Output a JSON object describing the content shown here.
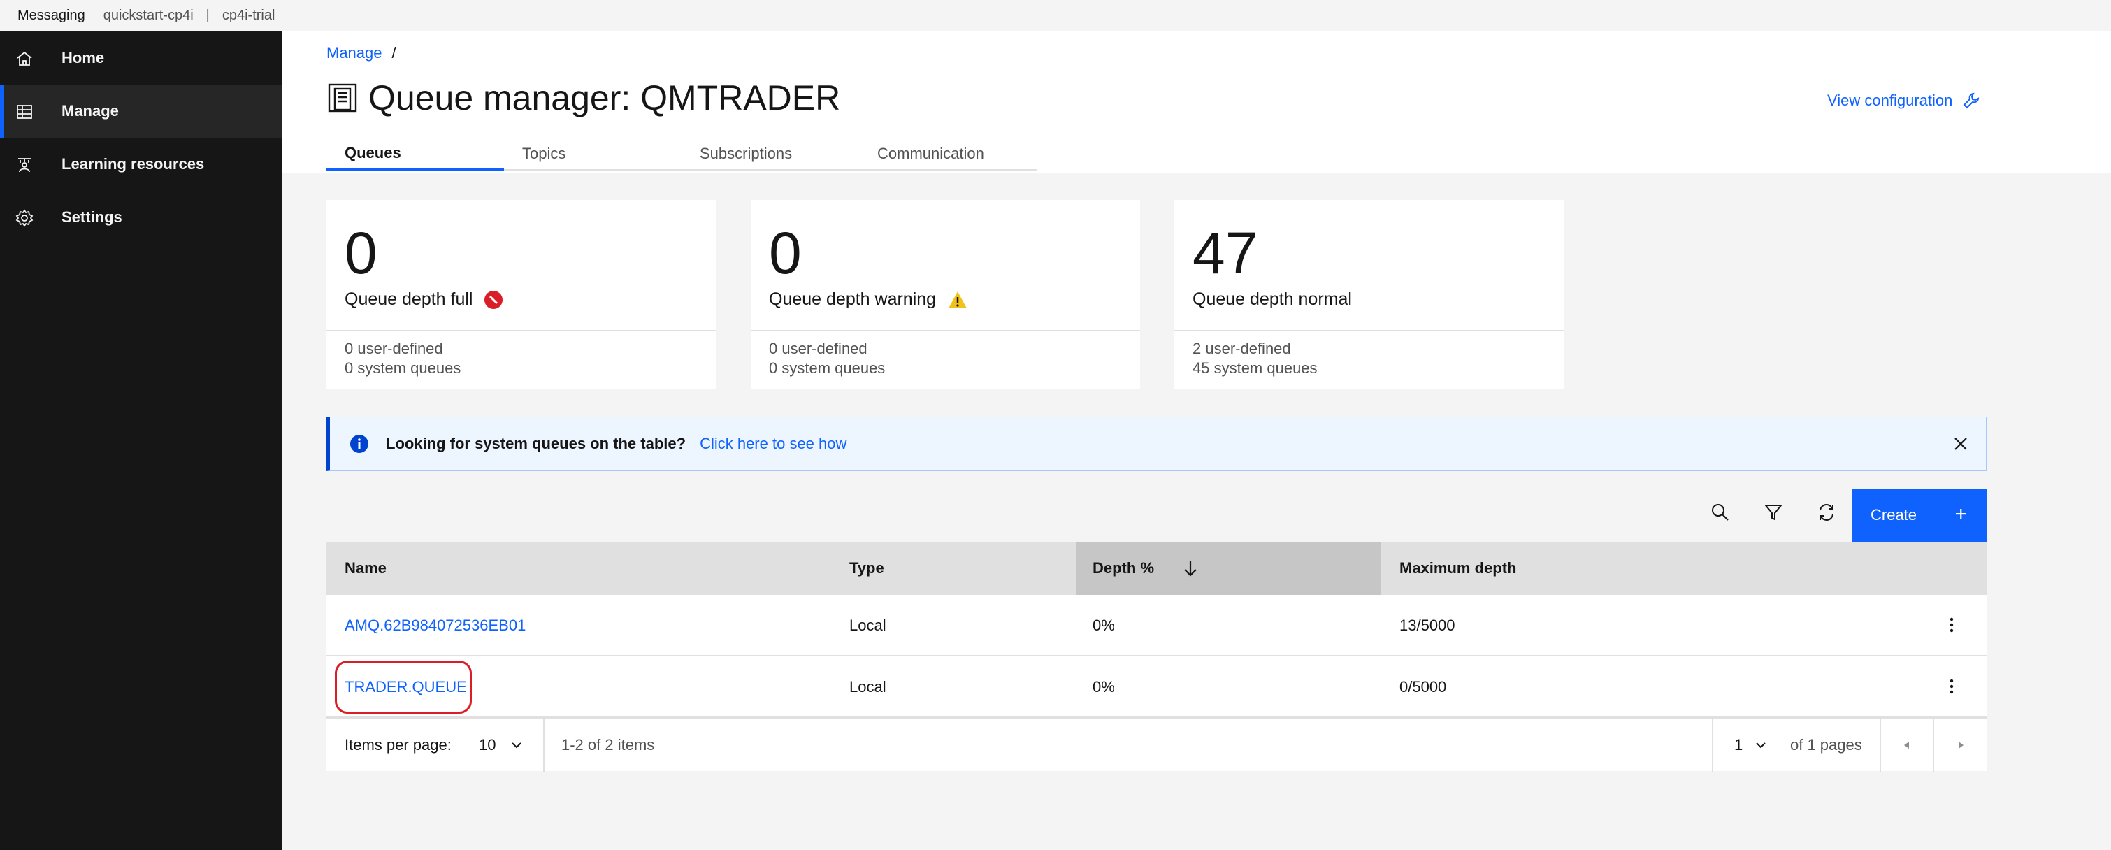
{
  "topbar": {
    "brand": "Messaging",
    "instance": "quickstart-cp4i",
    "separator": "|",
    "namespace": "cp4i-trial"
  },
  "sidebar": {
    "items": [
      {
        "label": "Home",
        "icon": "home-icon"
      },
      {
        "label": "Manage",
        "icon": "table-icon",
        "active": true
      },
      {
        "label": "Learning resources",
        "icon": "learning-icon"
      },
      {
        "label": "Settings",
        "icon": "gear-icon"
      }
    ]
  },
  "breadcrumb": {
    "root": "Manage",
    "separator": "/"
  },
  "page": {
    "title": "Queue manager: QMTRADER",
    "view_config": "View configuration"
  },
  "tabs": [
    {
      "label": "Queues",
      "active": true
    },
    {
      "label": "Topics"
    },
    {
      "label": "Subscriptions"
    },
    {
      "label": "Communication"
    }
  ],
  "tiles": [
    {
      "value": "0",
      "label": "Queue depth full",
      "status": "error",
      "user_defined": "0  user-defined",
      "system": "0  system queues"
    },
    {
      "value": "0",
      "label": "Queue depth warning",
      "status": "warning",
      "user_defined": "0  user-defined",
      "system": "0  system queues"
    },
    {
      "value": "47",
      "label": "Queue depth normal",
      "status": "none",
      "user_defined": "2  user-defined",
      "system": "45  system queues"
    }
  ],
  "notification": {
    "title": "Looking for system queues on the table?",
    "link": "Click here to see how"
  },
  "toolbar": {
    "create_label": "Create",
    "create_plus": "+"
  },
  "table": {
    "columns": [
      "Name",
      "Type",
      "Depth %",
      "Maximum depth"
    ],
    "sorted_column": "Depth %",
    "rows": [
      {
        "name": "AMQ.62B984072536EB01",
        "type": "Local",
        "depth": "0%",
        "max": "13/5000"
      },
      {
        "name": "TRADER.QUEUE",
        "type": "Local",
        "depth": "0%",
        "max": "0/5000",
        "highlighted": true
      }
    ]
  },
  "pagination": {
    "items_per_page_label": "Items per page:",
    "items_per_page": "10",
    "range": "1-2 of 2 items",
    "page": "1",
    "of_pages": "of 1 pages"
  },
  "colors": {
    "accent": "#0f62fe",
    "sidebar": "#161616",
    "error": "#da1e28",
    "warning": "#f1c21b"
  }
}
